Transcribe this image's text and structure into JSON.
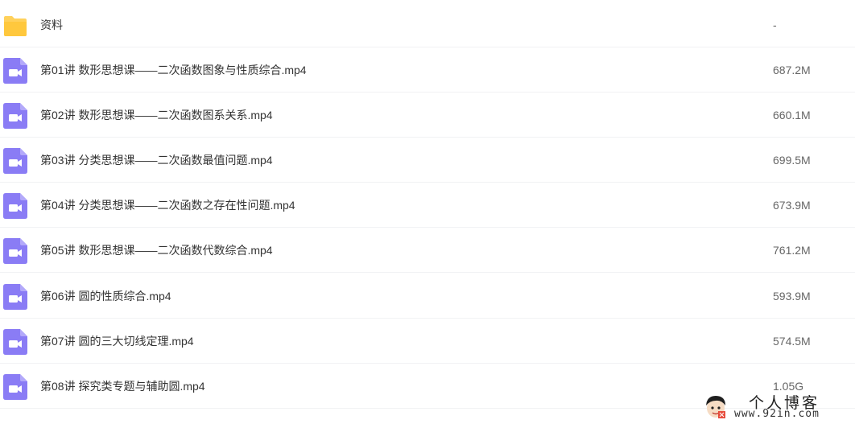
{
  "files": [
    {
      "name": "资料",
      "size": "-",
      "type": "folder"
    },
    {
      "name": "第01讲 数形思想课——二次函数图象与性质综合.mp4",
      "size": "687.2M",
      "type": "video"
    },
    {
      "name": "第02讲 数形思想课——二次函数图系关系.mp4",
      "size": "660.1M",
      "type": "video"
    },
    {
      "name": "第03讲 分类思想课——二次函数最值问题.mp4",
      "size": "699.5M",
      "type": "video"
    },
    {
      "name": "第04讲 分类思想课——二次函数之存在性问题.mp4",
      "size": "673.9M",
      "type": "video"
    },
    {
      "name": "第05讲 数形思想课——二次函数代数综合.mp4",
      "size": "761.2M",
      "type": "video"
    },
    {
      "name": "第06讲 圆的性质综合.mp4",
      "size": "593.9M",
      "type": "video"
    },
    {
      "name": "第07讲 圆的三大切线定理.mp4",
      "size": "574.5M",
      "type": "video"
    },
    {
      "name": "第08讲 探究类专题与辅助圆.mp4",
      "size": "1.05G",
      "type": "video"
    }
  ],
  "icons": {
    "folder": "folder-icon",
    "video": "video-file-icon"
  },
  "colors": {
    "folder": "#ffd15b",
    "video": "#8a7cf5",
    "text": "#333333",
    "size_text": "#666666"
  },
  "watermark": {
    "title": "个人博客",
    "url": "www.92in.com"
  }
}
